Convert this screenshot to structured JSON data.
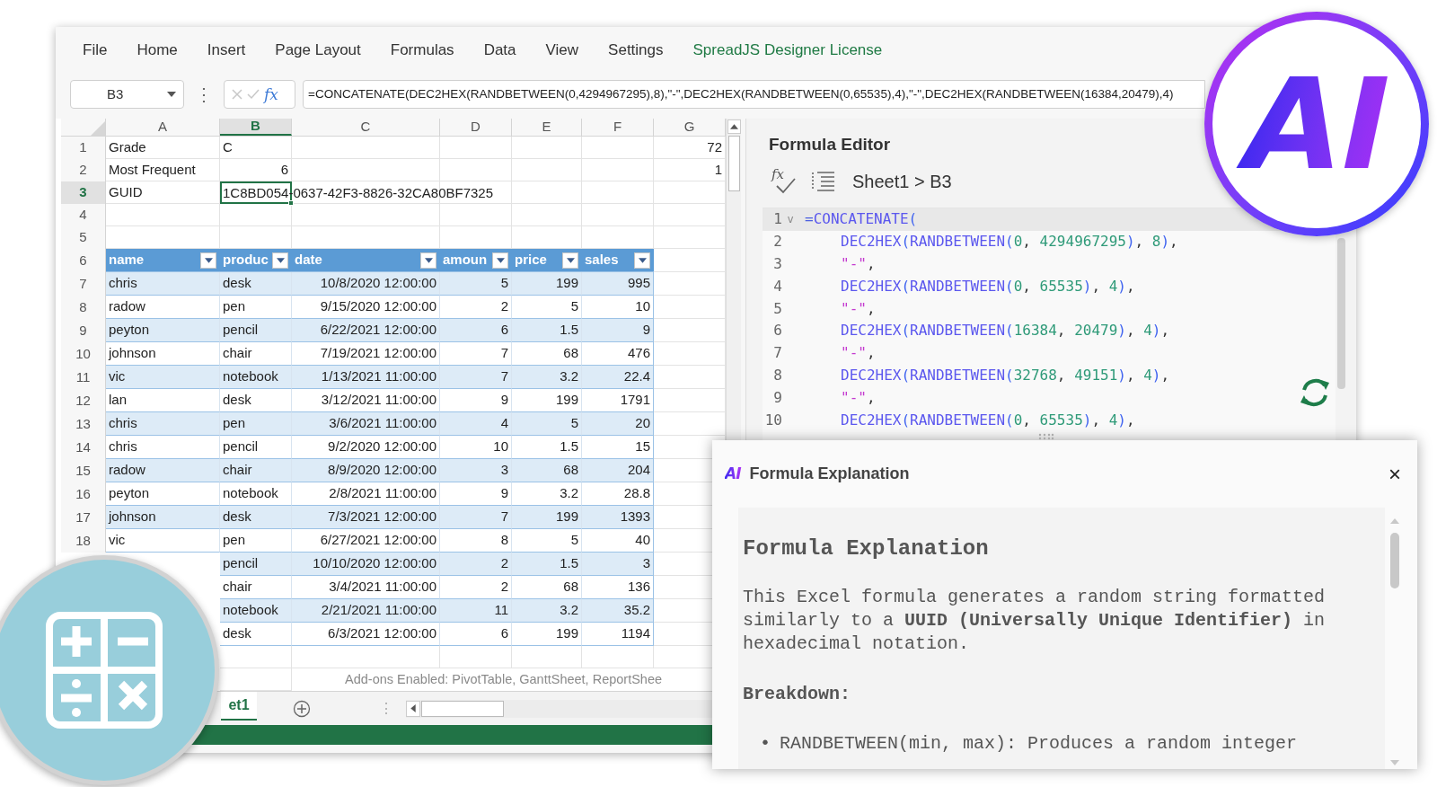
{
  "menu": [
    {
      "label": "File",
      "kind": "tab"
    },
    {
      "label": "Home",
      "kind": "tab"
    },
    {
      "label": "Insert",
      "kind": "tab"
    },
    {
      "label": "Page Layout",
      "kind": "tab"
    },
    {
      "label": "Formulas",
      "kind": "tab"
    },
    {
      "label": "Data",
      "kind": "tab"
    },
    {
      "label": "View",
      "kind": "tab"
    },
    {
      "label": "Settings",
      "kind": "tab"
    },
    {
      "label": "SpreadJS Designer License",
      "kind": "license"
    }
  ],
  "formula_bar": {
    "name_box": "B3",
    "more": "⋮",
    "fx": "fx",
    "formula": "=CONCATENATE(DEC2HEX(RANDBETWEEN(0,4294967295),8),\"-\",DEC2HEX(RANDBETWEEN(0,65535),4),\"-\",DEC2HEX(RANDBETWEEN(16384,20479),4)"
  },
  "sheet": {
    "columns": [
      {
        "label": "A",
        "selected": false
      },
      {
        "label": "B",
        "selected": true
      },
      {
        "label": "C",
        "selected": false
      },
      {
        "label": "D",
        "selected": false
      },
      {
        "label": "E",
        "selected": false
      },
      {
        "label": "F",
        "selected": false
      },
      {
        "label": "G",
        "selected": false
      }
    ],
    "top_rows": [
      {
        "number": "1",
        "selected": false,
        "cells": [
          {
            "text": "Grade",
            "kind": "text",
            "active": false
          },
          {
            "text": "C",
            "kind": "text",
            "active": false
          },
          null,
          null,
          null,
          null,
          {
            "text": "72",
            "kind": "number",
            "active": false
          }
        ]
      },
      {
        "number": "2",
        "selected": false,
        "cells": [
          {
            "text": "Most Frequent",
            "kind": "text",
            "active": false
          },
          {
            "text": "6",
            "kind": "number",
            "active": false
          },
          null,
          null,
          null,
          null,
          {
            "text": "1",
            "kind": "number",
            "active": false
          }
        ]
      },
      {
        "number": "3",
        "selected": true,
        "cells": [
          {
            "text": "GUID",
            "kind": "text",
            "active": false
          },
          {
            "text": "1C8BD054-0637-42F3-8826-32CA80BF7325",
            "kind": "text",
            "active": true
          },
          null,
          null,
          null,
          null,
          null
        ]
      },
      {
        "number": "4",
        "selected": false,
        "cells": [
          null,
          null,
          null,
          null,
          null,
          null,
          null
        ]
      },
      {
        "number": "5",
        "selected": false,
        "cells": [
          null,
          null,
          null,
          null,
          null,
          null,
          null
        ]
      }
    ],
    "table": {
      "header_number": "6",
      "columns": [
        {
          "label": "name",
          "kind": "text"
        },
        {
          "label": "produc",
          "kind": "text"
        },
        {
          "label": "date",
          "kind": "number"
        },
        {
          "label": "amoun",
          "kind": "number"
        },
        {
          "label": "price",
          "kind": "number"
        },
        {
          "label": "sales",
          "kind": "number"
        }
      ],
      "rows": [
        {
          "number": "7",
          "cells": [
            "chris",
            "desk",
            "10/8/2020 12:00:00",
            "5",
            "199",
            "995"
          ]
        },
        {
          "number": "8",
          "cells": [
            "radow",
            "pen",
            "9/15/2020 12:00:00",
            "2",
            "5",
            "10"
          ]
        },
        {
          "number": "9",
          "cells": [
            "peyton",
            "pencil",
            "6/22/2021 12:00:00",
            "6",
            "1.5",
            "9"
          ]
        },
        {
          "number": "10",
          "cells": [
            "johnson",
            "chair",
            "7/19/2021 12:00:00",
            "7",
            "68",
            "476"
          ]
        },
        {
          "number": "11",
          "cells": [
            "vic",
            "notebook",
            "1/13/2021 11:00:00",
            "7",
            "3.2",
            "22.4"
          ]
        },
        {
          "number": "12",
          "cells": [
            "lan",
            "desk",
            "3/12/2021 11:00:00",
            "9",
            "199",
            "1791"
          ]
        },
        {
          "number": "13",
          "cells": [
            "chris",
            "pen",
            "3/6/2021 11:00:00",
            "4",
            "5",
            "20"
          ]
        },
        {
          "number": "14",
          "cells": [
            "chris",
            "pencil",
            "9/2/2020 12:00:00",
            "10",
            "1.5",
            "15"
          ]
        },
        {
          "number": "15",
          "cells": [
            "radow",
            "chair",
            "8/9/2020 12:00:00",
            "3",
            "68",
            "204"
          ]
        },
        {
          "number": "16",
          "cells": [
            "peyton",
            "notebook",
            "2/8/2021 11:00:00",
            "9",
            "3.2",
            "28.8"
          ]
        },
        {
          "number": "17",
          "cells": [
            "johnson",
            "desk",
            "7/3/2021 12:00:00",
            "7",
            "199",
            "1393"
          ]
        },
        {
          "number": "18",
          "cells": [
            "vic",
            "pen",
            "6/27/2021 12:00:00",
            "8",
            "5",
            "40"
          ]
        },
        {
          "cells": [
            null,
            "pencil",
            "10/10/2020 12:00:00",
            "2",
            "1.5",
            "3"
          ]
        },
        {
          "cells": [
            null,
            "chair",
            "3/4/2021 11:00:00",
            "2",
            "68",
            "136"
          ]
        },
        {
          "cells": [
            null,
            "notebook",
            "2/21/2021 11:00:00",
            "11",
            "3.2",
            "35.2"
          ]
        },
        {
          "cells": [
            null,
            "desk",
            "6/3/2021 12:00:00",
            "6",
            "199",
            "1194"
          ]
        }
      ]
    },
    "notice": "Add-ons Enabled: PivotTable, GanttSheet, ReportShee",
    "sheet_tab": {
      "label": "et1",
      "selected": true
    },
    "more": "⋮"
  },
  "formula_editor": {
    "title": "Formula Editor",
    "fx": "fx",
    "breadcrumb": "Sheet1 > B3",
    "lines": [
      {
        "number": "1",
        "fold": "v",
        "selected": true,
        "tokens": [
          {
            "kind": "op",
            "text": "="
          },
          {
            "kind": "fn",
            "text": "CONCATENATE"
          },
          {
            "kind": "paren",
            "text": "("
          }
        ],
        "children": [
          {
            "number": "2",
            "selected": false,
            "tokens": [
              {
                "kind": "fn",
                "text": "DEC2HEX"
              },
              {
                "kind": "paren",
                "text": "("
              },
              {
                "kind": "fn",
                "text": "RANDBETWEEN"
              },
              {
                "kind": "paren",
                "text": "("
              },
              {
                "kind": "num",
                "text": "0"
              },
              {
                "kind": "punct",
                "text": ", "
              },
              {
                "kind": "num",
                "text": "4294967295"
              },
              {
                "kind": "paren",
                "text": ")"
              },
              {
                "kind": "punct",
                "text": ", "
              },
              {
                "kind": "num",
                "text": "8"
              },
              {
                "kind": "paren",
                "text": ")"
              },
              {
                "kind": "punct",
                "text": ","
              }
            ]
          },
          {
            "number": "3",
            "selected": false,
            "tokens": [
              {
                "kind": "str",
                "text": "\"-\""
              },
              {
                "kind": "punct",
                "text": ","
              }
            ]
          },
          {
            "number": "4",
            "selected": false,
            "tokens": [
              {
                "kind": "fn",
                "text": "DEC2HEX"
              },
              {
                "kind": "paren",
                "text": "("
              },
              {
                "kind": "fn",
                "text": "RANDBETWEEN"
              },
              {
                "kind": "paren",
                "text": "("
              },
              {
                "kind": "num",
                "text": "0"
              },
              {
                "kind": "punct",
                "text": ", "
              },
              {
                "kind": "num",
                "text": "65535"
              },
              {
                "kind": "paren",
                "text": ")"
              },
              {
                "kind": "punct",
                "text": ", "
              },
              {
                "kind": "num",
                "text": "4"
              },
              {
                "kind": "paren",
                "text": ")"
              },
              {
                "kind": "punct",
                "text": ","
              }
            ]
          },
          {
            "number": "5",
            "selected": false,
            "tokens": [
              {
                "kind": "str",
                "text": "\"-\""
              },
              {
                "kind": "punct",
                "text": ","
              }
            ]
          },
          {
            "number": "6",
            "selected": false,
            "tokens": [
              {
                "kind": "fn",
                "text": "DEC2HEX"
              },
              {
                "kind": "paren",
                "text": "("
              },
              {
                "kind": "fn",
                "text": "RANDBETWEEN"
              },
              {
                "kind": "paren",
                "text": "("
              },
              {
                "kind": "num",
                "text": "16384"
              },
              {
                "kind": "punct",
                "text": ", "
              },
              {
                "kind": "num",
                "text": "20479"
              },
              {
                "kind": "paren",
                "text": ")"
              },
              {
                "kind": "punct",
                "text": ", "
              },
              {
                "kind": "num",
                "text": "4"
              },
              {
                "kind": "paren",
                "text": ")"
              },
              {
                "kind": "punct",
                "text": ","
              }
            ]
          },
          {
            "number": "7",
            "selected": false,
            "tokens": [
              {
                "kind": "str",
                "text": "\"-\""
              },
              {
                "kind": "punct",
                "text": ","
              }
            ]
          },
          {
            "number": "8",
            "selected": false,
            "tokens": [
              {
                "kind": "fn",
                "text": "DEC2HEX"
              },
              {
                "kind": "paren",
                "text": "("
              },
              {
                "kind": "fn",
                "text": "RANDBETWEEN"
              },
              {
                "kind": "paren",
                "text": "("
              },
              {
                "kind": "num",
                "text": "32768"
              },
              {
                "kind": "punct",
                "text": ", "
              },
              {
                "kind": "num",
                "text": "49151"
              },
              {
                "kind": "paren",
                "text": ")"
              },
              {
                "kind": "punct",
                "text": ", "
              },
              {
                "kind": "num",
                "text": "4"
              },
              {
                "kind": "paren",
                "text": ")"
              },
              {
                "kind": "punct",
                "text": ","
              }
            ]
          },
          {
            "number": "9",
            "selected": false,
            "tokens": [
              {
                "kind": "str",
                "text": "\"-\""
              },
              {
                "kind": "punct",
                "text": ","
              }
            ]
          },
          {
            "number": "10",
            "selected": false,
            "tokens": [
              {
                "kind": "fn",
                "text": "DEC2HEX"
              },
              {
                "kind": "paren",
                "text": "("
              },
              {
                "kind": "fn",
                "text": "RANDBETWEEN"
              },
              {
                "kind": "paren",
                "text": "("
              },
              {
                "kind": "num",
                "text": "0"
              },
              {
                "kind": "punct",
                "text": ", "
              },
              {
                "kind": "num",
                "text": "65535"
              },
              {
                "kind": "paren",
                "text": ")"
              },
              {
                "kind": "punct",
                "text": ", "
              },
              {
                "kind": "num",
                "text": "4"
              },
              {
                "kind": "paren",
                "text": ")"
              },
              {
                "kind": "punct",
                "text": ","
              }
            ]
          }
        ]
      }
    ]
  },
  "explanation_dialog": {
    "logo": "AI",
    "title": "Formula Explanation",
    "close": "×",
    "heading": "Formula Explanation",
    "paragraph": "This Excel formula generates a random string formatted similarly to a **UUID (Universally Unique Identifier)** in hexadecimal notation.",
    "subheading": "Breakdown:",
    "bullets": [
      {
        "marker": "•",
        "text": "RANDBETWEEN(min, max): Produces a random integer"
      }
    ]
  },
  "ai_badge": {
    "logo": "AI"
  }
}
